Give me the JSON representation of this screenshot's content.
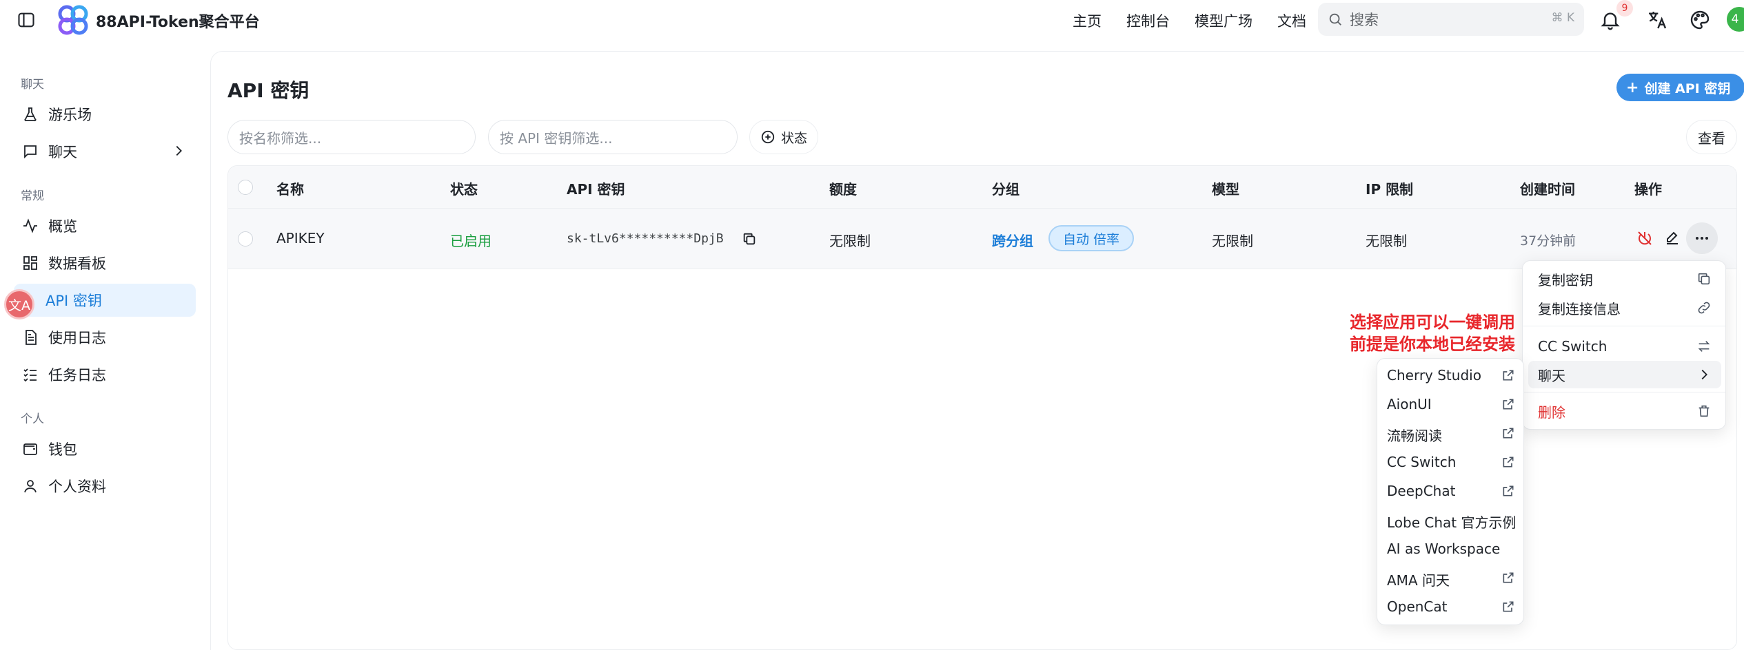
{
  "topbar": {
    "app_title": "88API-Token聚合平台",
    "nav": [
      "主页",
      "控制台",
      "模型广场",
      "文档"
    ],
    "search_placeholder": "搜索",
    "search_shortcut": "⌘ K",
    "notification_count": "9",
    "avatar_text": "4"
  },
  "sidebar": {
    "sections": [
      {
        "label": "聊天",
        "items": [
          {
            "label": "游乐场",
            "icon": "flask-icon"
          },
          {
            "label": "聊天",
            "icon": "chat-icon"
          }
        ]
      },
      {
        "label": "常规",
        "items": [
          {
            "label": "概览",
            "icon": "activity-icon"
          },
          {
            "label": "数据看板",
            "icon": "dashboard-icon"
          },
          {
            "label": "API 密钥",
            "icon": "key-icon"
          },
          {
            "label": "使用日志",
            "icon": "log-icon"
          },
          {
            "label": "任务日志",
            "icon": "tasklist-icon"
          }
        ]
      },
      {
        "label": "个人",
        "items": [
          {
            "label": "钱包",
            "icon": "wallet-icon"
          },
          {
            "label": "个人资料",
            "icon": "user-icon"
          }
        ]
      }
    ],
    "floating_avatar_text": "文A"
  },
  "main": {
    "title": "API 密钥",
    "create_button": "创建 API 密钥",
    "filter_name_placeholder": "按名称筛选...",
    "filter_key_placeholder": "按 API 密钥筛选...",
    "status_button": "状态",
    "view_button": "查看",
    "table": {
      "columns": [
        "名称",
        "状态",
        "API 密钥",
        "额度",
        "分组",
        "模型",
        "IP 限制",
        "创建时间",
        "操作"
      ],
      "rows": [
        {
          "name": "APIKEY",
          "status": "已启用",
          "key": "sk-tLv6**********DpjB",
          "quota": "无限制",
          "group": "跨分组",
          "group_tag": "自动 倍率",
          "models": "无限制",
          "ip": "无限制",
          "created": "37分钟前"
        }
      ]
    }
  },
  "context_menu": {
    "items": [
      "复制密钥",
      "复制连接信息",
      "CC Switch",
      "聊天",
      "删除"
    ]
  },
  "submenu": {
    "items": [
      "Cherry Studio",
      "AionUI",
      "流畅阅读",
      "CC Switch",
      "DeepChat",
      "Lobe Chat 官方示例",
      "AI as Workspace",
      "AMA 问天",
      "OpenCat"
    ]
  },
  "annotation": {
    "line1": "选择应用可以一键调用",
    "line2": "前提是你本地已经安装"
  },
  "colors": {
    "accent": "#3b8fe6",
    "active_bg": "#e8f3ff",
    "success": "#1a9e3f",
    "danger": "#e03131"
  }
}
